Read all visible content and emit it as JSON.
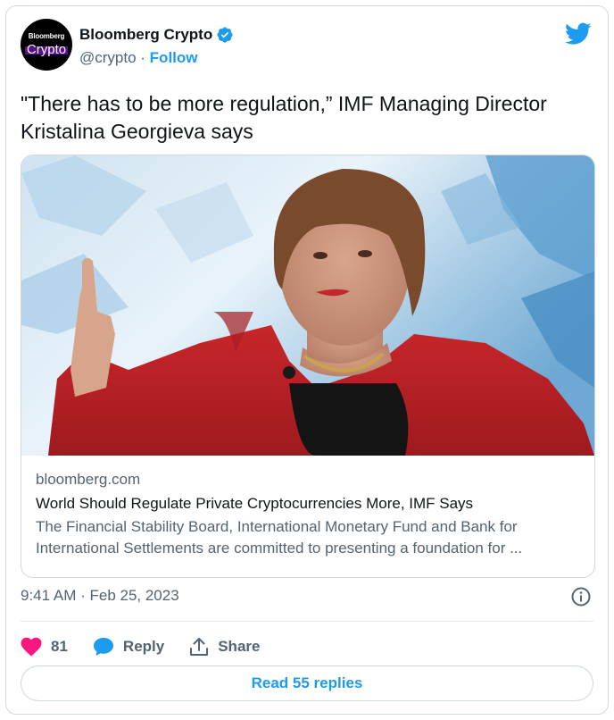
{
  "author": {
    "avatar_line1": "Bloomberg",
    "avatar_line2": "Crypto",
    "name": "Bloomberg Crypto",
    "handle": "@crypto",
    "separator": " · ",
    "follow_label": "Follow"
  },
  "tweet": {
    "text": "\"There has to be more regulation,” IMF Managing Director Kristalina Georgieva says"
  },
  "link_card": {
    "domain": "bloomberg.com",
    "title": "World Should Regulate Private Cryptocurrencies More, IMF Says",
    "description": "The Financial Stability Board, International Monetary Fund and Bank for International Settlements are committed to presenting a foundation for ..."
  },
  "meta": {
    "timestamp": "9:41 AM · Feb 25, 2023"
  },
  "actions": {
    "like_count": "81",
    "reply_label": "Reply",
    "share_label": "Share"
  },
  "read_replies_label": "Read 55 replies",
  "icons": {
    "verified": "verified-badge-icon",
    "bird": "twitter-bird-icon",
    "info": "info-icon",
    "heart": "heart-icon",
    "reply": "reply-bubble-icon",
    "share": "share-upload-icon"
  },
  "colors": {
    "accent": "#1d9bf0",
    "like": "#f91880",
    "text_primary": "#0f1419",
    "text_secondary": "#536471",
    "border": "#cfd9de"
  }
}
